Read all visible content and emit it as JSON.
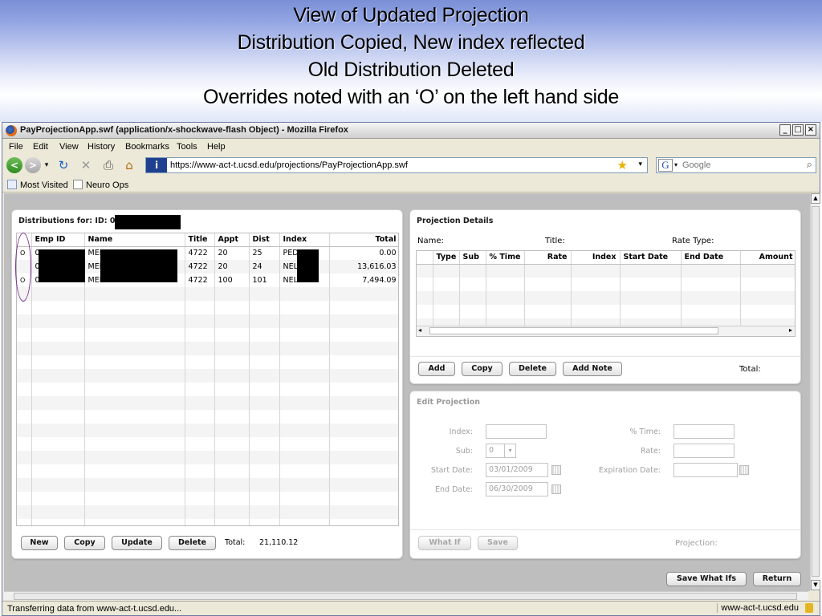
{
  "slide": {
    "title_lines": [
      "View of Updated Projection",
      "Distribution Copied, New index reflected",
      "Old Distribution Deleted",
      "Overrides noted with an ‘O’ on the left hand side"
    ]
  },
  "browser": {
    "window_title": "PayProjectionApp.swf (application/x-shockwave-flash Object) - Mozilla Firefox",
    "menu": [
      "File",
      "Edit",
      "View",
      "History",
      "Bookmarks",
      "Tools",
      "Help"
    ],
    "url": "https://www-act-t.ucsd.edu/projections/PayProjectionApp.swf",
    "search_placeholder": "Google",
    "bookmarks": [
      "Most Visited",
      "Neuro Ops"
    ],
    "status_message": "Transferring data from www-act-t.ucsd.edu...",
    "status_host": "www-act-t.ucsd.edu"
  },
  "distributions": {
    "title": "Distributions for: ID: 0",
    "columns": [
      "Emp ID",
      "Name",
      "Title",
      "Appt",
      "Dist",
      "Index",
      "Total"
    ],
    "rows": [
      {
        "flag": "O",
        "emp_id": "0",
        "name": "MEL",
        "title": "4722",
        "appt": "20",
        "dist": "25",
        "index": "PED",
        "total": "0.00"
      },
      {
        "flag": "",
        "emp_id": "0",
        "name": "MEL",
        "title": "4722",
        "appt": "20",
        "dist": "24",
        "index": "NEL",
        "total": "13,616.03"
      },
      {
        "flag": "O",
        "emp_id": "0",
        "name": "MEL",
        "title": "4722",
        "appt": "100",
        "dist": "101",
        "index": "NEL",
        "total": "7,494.09"
      }
    ],
    "buttons": {
      "new": "New",
      "copy": "Copy",
      "update": "Update",
      "delete": "Delete"
    },
    "total_label": "Total:",
    "total_value": "21,110.12"
  },
  "projection_details": {
    "title": "Projection Details",
    "name_label": "Name:",
    "title_label": "Title:",
    "rate_type_label": "Rate Type:",
    "columns": [
      "Type",
      "Sub",
      "% Time",
      "Rate",
      "Index",
      "Start Date",
      "End Date",
      "Amount"
    ],
    "buttons": {
      "add": "Add",
      "copy": "Copy",
      "delete": "Delete",
      "add_note": "Add Note"
    },
    "total_label": "Total:"
  },
  "edit_projection": {
    "title": "Edit Projection",
    "index_label": "Index:",
    "sub_label": "Sub:",
    "sub_value": "0",
    "start_date_label": "Start Date:",
    "start_date_value": "03/01/2009",
    "end_date_label": "End Date:",
    "end_date_value": "06/30/2009",
    "pct_time_label": "% Time:",
    "rate_label": "Rate:",
    "expiration_label": "Expiration Date:",
    "buttons": {
      "what_if": "What If",
      "save": "Save"
    },
    "projection_label": "Projection:"
  },
  "footer_buttons": {
    "save_what_ifs": "Save What Ifs",
    "return": "Return"
  }
}
